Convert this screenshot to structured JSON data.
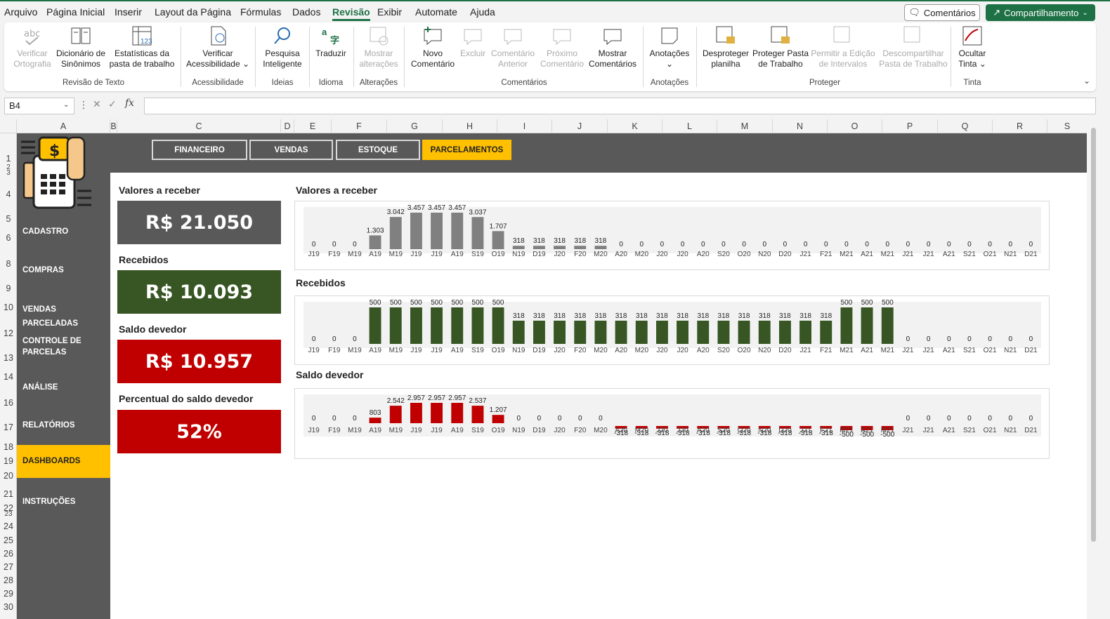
{
  "menu": {
    "items": [
      "Arquivo",
      "Página Inicial",
      "Inserir",
      "Layout da Página",
      "Fórmulas",
      "Dados",
      "Revisão",
      "Exibir",
      "Automate",
      "Ajuda"
    ],
    "active": "Revisão",
    "comments_label": "Comentários",
    "share_label": "Compartilhamento"
  },
  "ribbon": {
    "buttons": [
      {
        "label": "Verificar Ortografia",
        "disabled": true
      },
      {
        "label": "Dicionário de Sinônimos",
        "disabled": false
      },
      {
        "label": "Estatísticas da pasta de trabalho",
        "disabled": false
      },
      {
        "label": "Verificar Acessibilidade ⌄",
        "disabled": false
      },
      {
        "label": "Pesquisa Inteligente",
        "disabled": false
      },
      {
        "label": "Traduzir",
        "disabled": false
      },
      {
        "label": "Mostrar alterações",
        "disabled": true
      },
      {
        "label": "Novo Comentário",
        "disabled": false
      },
      {
        "label": "Excluir",
        "disabled": true
      },
      {
        "label": "Comentário Anterior",
        "disabled": true
      },
      {
        "label": "Próximo Comentário",
        "disabled": true
      },
      {
        "label": "Mostrar Comentários",
        "disabled": false
      },
      {
        "label": "Anotações ⌄",
        "disabled": false
      },
      {
        "label": "Desproteger planilha",
        "disabled": false
      },
      {
        "label": "Proteger Pasta de Trabalho",
        "disabled": false
      },
      {
        "label": "Permitir a Edição de Intervalos",
        "disabled": true
      },
      {
        "label": "Descompartilhar Pasta de Trabalho",
        "disabled": true
      },
      {
        "label": "Ocultar Tinta ⌄",
        "disabled": false
      }
    ],
    "groups": [
      "Revisão de Texto",
      "Acessibilidade",
      "Ideias",
      "Idioma",
      "Alterações",
      "Comentários",
      "Anotações",
      "Proteger",
      "Tinta"
    ]
  },
  "formula_bar": {
    "name_box": "B4",
    "formula": ""
  },
  "columns": [
    "A",
    "B",
    "C",
    "D",
    "E",
    "F",
    "G",
    "H",
    "I",
    "J",
    "K",
    "L",
    "M",
    "N",
    "O",
    "P",
    "Q",
    "R",
    "S"
  ],
  "rows": [
    "1",
    "2",
    "3",
    "4",
    "5",
    "6",
    "8",
    "9",
    "10",
    "12",
    "13",
    "14",
    "16",
    "17",
    "18",
    "19",
    "20",
    "21",
    "22",
    "23",
    "24",
    "25",
    "26",
    "27",
    "28",
    "29",
    "30"
  ],
  "nav_tabs": [
    {
      "label": "FINANCEIRO",
      "active": false
    },
    {
      "label": "VENDAS",
      "active": false
    },
    {
      "label": "ESTOQUE",
      "active": false
    },
    {
      "label": "PARCELAMENTOS",
      "active": true
    }
  ],
  "sidebar": [
    {
      "label": "CADASTRO",
      "active": false
    },
    {
      "label": "COMPRAS",
      "active": false
    },
    {
      "label": "VENDAS PARCELADAS",
      "active": false
    },
    {
      "label": "CONTROLE DE PARCELAS",
      "active": false
    },
    {
      "label": "ANÁLISE",
      "active": false
    },
    {
      "label": "RELATÓRIOS",
      "active": false
    },
    {
      "label": "DASHBOARDS",
      "active": true
    },
    {
      "label": "INSTRUÇÕES",
      "active": false
    }
  ],
  "kpis": [
    {
      "label": "Valores a receber",
      "value": "R$ 21.050",
      "color": "#595959"
    },
    {
      "label": "Recebidos",
      "value": "R$ 10.093",
      "color": "#375623"
    },
    {
      "label": "Saldo devedor",
      "value": "R$ 10.957",
      "color": "#c00000"
    },
    {
      "label": "Percentual do saldo devedor",
      "value": "52%",
      "color": "#c00000"
    }
  ],
  "chart_data": [
    {
      "type": "bar",
      "title": "Valores a receber",
      "color": "#808080",
      "categories": [
        "J19",
        "F19",
        "M19",
        "A19",
        "M19",
        "J19",
        "J19",
        "A19",
        "S19",
        "O19",
        "N19",
        "D19",
        "J20",
        "F20",
        "M20",
        "A20",
        "M20",
        "J20",
        "J20",
        "A20",
        "S20",
        "O20",
        "N20",
        "D20",
        "J21",
        "F21",
        "M21",
        "A21",
        "M21",
        "J21",
        "J21",
        "A21",
        "S21",
        "O21",
        "N21",
        "D21"
      ],
      "values": [
        0,
        0,
        0,
        1303,
        3042,
        3457,
        3457,
        3457,
        3037,
        1707,
        318,
        318,
        318,
        318,
        318,
        0,
        0,
        0,
        0,
        0,
        0,
        0,
        0,
        0,
        0,
        0,
        0,
        0,
        0,
        0,
        0,
        0,
        0,
        0,
        0,
        0
      ],
      "labels": [
        "0",
        "0",
        "0",
        "1.303",
        "3.042",
        "3.457",
        "3.457",
        "3.457",
        "3.037",
        "1.707",
        "318",
        "318",
        "318",
        "318",
        "318",
        "0",
        "0",
        "0",
        "0",
        "0",
        "0",
        "0",
        "0",
        "0",
        "0",
        "0",
        "0",
        "0",
        "0",
        "0",
        "0",
        "0",
        "0",
        "0",
        "0",
        "0"
      ]
    },
    {
      "type": "bar",
      "title": "Recebidos",
      "color": "#375623",
      "categories": [
        "J19",
        "F19",
        "M19",
        "A19",
        "M19",
        "J19",
        "J19",
        "A19",
        "S19",
        "O19",
        "N19",
        "D19",
        "J20",
        "F20",
        "M20",
        "A20",
        "M20",
        "J20",
        "J20",
        "A20",
        "S20",
        "O20",
        "N20",
        "D20",
        "J21",
        "F21",
        "M21",
        "A21",
        "M21",
        "J21",
        "J21",
        "A21",
        "S21",
        "O21",
        "N21",
        "D21"
      ],
      "values": [
        0,
        0,
        0,
        500,
        500,
        500,
        500,
        500,
        500,
        500,
        318,
        318,
        318,
        318,
        318,
        318,
        318,
        318,
        318,
        318,
        318,
        318,
        318,
        318,
        318,
        318,
        500,
        500,
        500,
        0,
        0,
        0,
        0,
        0,
        0,
        0
      ],
      "labels": [
        "0",
        "0",
        "0",
        "500",
        "500",
        "500",
        "500",
        "500",
        "500",
        "500",
        "318",
        "318",
        "318",
        "318",
        "318",
        "318",
        "318",
        "318",
        "318",
        "318",
        "318",
        "318",
        "318",
        "318",
        "318",
        "318",
        "500",
        "500",
        "500",
        "0",
        "0",
        "0",
        "0",
        "0",
        "0",
        "0"
      ]
    },
    {
      "type": "bar",
      "title": "Saldo devedor",
      "color": "#c00000",
      "categories": [
        "J19",
        "F19",
        "M19",
        "A19",
        "M19",
        "J19",
        "J19",
        "A19",
        "S19",
        "O19",
        "N19",
        "D19",
        "J20",
        "F20",
        "M20",
        "A20",
        "M20",
        "J20",
        "J20",
        "A20",
        "S20",
        "O20",
        "N20",
        "D20",
        "J21",
        "F21",
        "M21",
        "A21",
        "M21",
        "J21",
        "J21",
        "A21",
        "S21",
        "O21",
        "N21",
        "D21"
      ],
      "values": [
        0,
        0,
        0,
        803,
        2542,
        2957,
        2957,
        2957,
        2537,
        1207,
        0,
        0,
        0,
        0,
        0,
        -318,
        -318,
        -318,
        -318,
        -318,
        -318,
        -318,
        -318,
        -318,
        -318,
        -318,
        -500,
        -500,
        -500,
        0,
        0,
        0,
        0,
        0,
        0,
        0
      ],
      "labels": [
        "0",
        "0",
        "0",
        "803",
        "2.542",
        "2.957",
        "2.957",
        "2.957",
        "2.537",
        "1.207",
        "0",
        "0",
        "0",
        "0",
        "0",
        "-318",
        "-318",
        "-318",
        "-318",
        "-318",
        "-318",
        "-318",
        "-318",
        "-318",
        "-318",
        "-318",
        "-500",
        "-500",
        "-500",
        "0",
        "0",
        "0",
        "0",
        "0",
        "0",
        "0"
      ]
    }
  ]
}
